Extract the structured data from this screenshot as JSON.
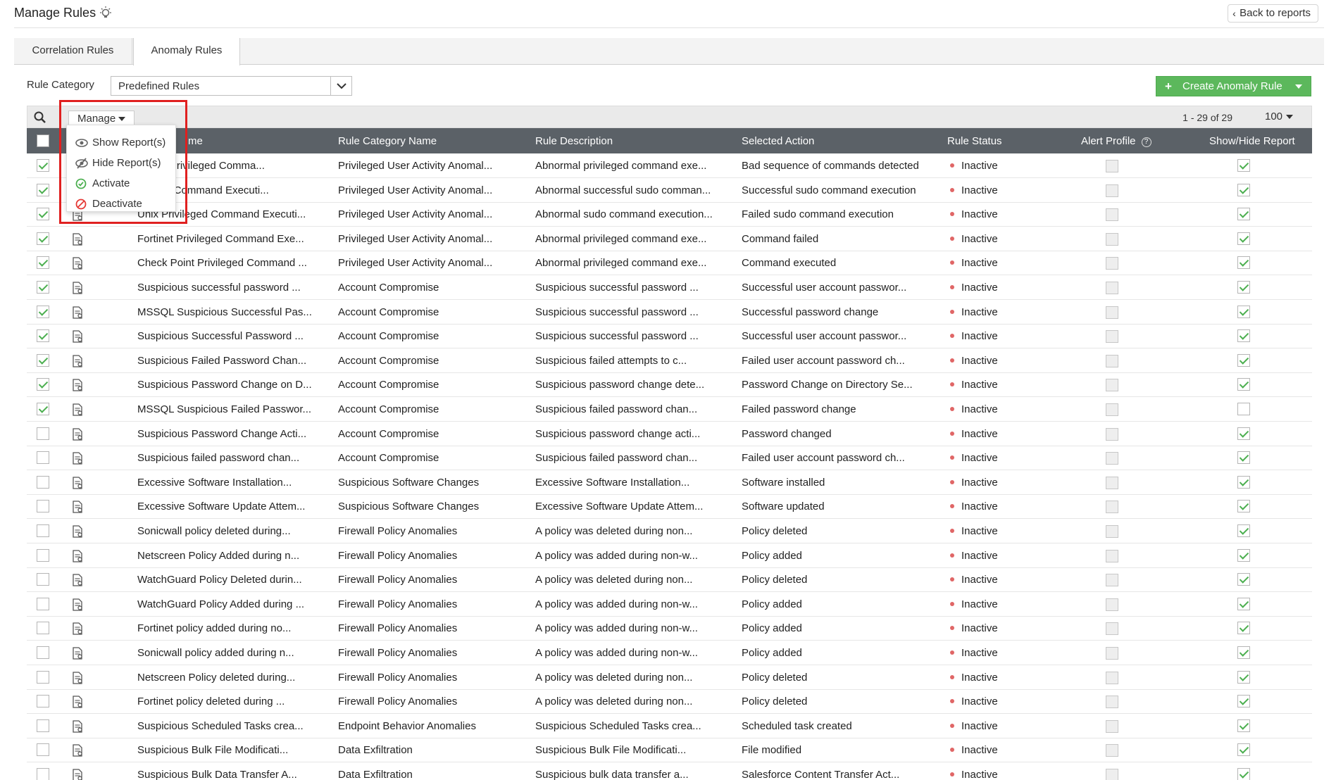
{
  "header": {
    "title": "Manage Rules",
    "back_label": "Back to reports"
  },
  "tabs": [
    {
      "label": "Correlation Rules"
    },
    {
      "label": "Anomaly Rules",
      "active": true
    }
  ],
  "filter": {
    "label": "Rule Category",
    "value": "Predefined Rules"
  },
  "create_button": {
    "label": "Create Anomaly Rule"
  },
  "toolbar": {
    "manage_label": "Manage",
    "pager": "1 - 29 of 29",
    "per_page": "100"
  },
  "manage_menu": [
    {
      "label": "Show Report(s)",
      "icon": "eye-icon"
    },
    {
      "label": "Hide Report(s)",
      "icon": "eye-slash-icon"
    },
    {
      "label": "Activate",
      "icon": "check-circle-icon",
      "color": "#4caf50"
    },
    {
      "label": "Deactivate",
      "icon": "ban-icon",
      "color": "#e53935"
    }
  ],
  "columns": [
    "me",
    "Rule Category Name",
    "Rule Description",
    "Selected Action",
    "Rule Status",
    "Alert Profile",
    "Show/Hide Report"
  ],
  "rows": [
    {
      "checked": true,
      "name": "server Privileged Comma...",
      "category": "Privileged User Activity Anomal...",
      "description": "Abnormal privileged command exe...",
      "action": "Bad sequence of commands detected",
      "status": "Inactive",
      "show": true
    },
    {
      "checked": true,
      "name": "vileged Command Executi...",
      "category": "Privileged User Activity Anomal...",
      "description": "Abnormal successful sudo comman...",
      "action": "Successful sudo command execution",
      "status": "Inactive",
      "show": true
    },
    {
      "checked": true,
      "name": "Unix Privileged Command Executi...",
      "category": "Privileged User Activity Anomal...",
      "description": "Abnormal sudo command execution...",
      "action": "Failed sudo command execution",
      "status": "Inactive",
      "show": true
    },
    {
      "checked": true,
      "name": "Fortinet Privileged Command Exe...",
      "category": "Privileged User Activity Anomal...",
      "description": "Abnormal privileged command exe...",
      "action": "Command failed",
      "status": "Inactive",
      "show": true
    },
    {
      "checked": true,
      "name": "Check Point Privileged Command ...",
      "category": "Privileged User Activity Anomal...",
      "description": "Abnormal privileged command exe...",
      "action": "Command executed",
      "status": "Inactive",
      "show": true
    },
    {
      "checked": true,
      "name": "Suspicious successful password ...",
      "category": "Account Compromise",
      "description": "Suspicious successful password ...",
      "action": "Successful user account passwor...",
      "status": "Inactive",
      "show": true
    },
    {
      "checked": true,
      "name": "MSSQL Suspicious Successful Pas...",
      "category": "Account Compromise",
      "description": "Suspicious successful password ...",
      "action": "Successful password change",
      "status": "Inactive",
      "show": true
    },
    {
      "checked": true,
      "name": "Suspicious Successful Password ...",
      "category": "Account Compromise",
      "description": "Suspicious successful password ...",
      "action": "Successful user account passwor...",
      "status": "Inactive",
      "show": true
    },
    {
      "checked": true,
      "name": "Suspicious Failed Password Chan...",
      "category": "Account Compromise",
      "description": "Suspicious failed attempts to c...",
      "action": "Failed user account password ch...",
      "status": "Inactive",
      "show": true
    },
    {
      "checked": true,
      "name": "Suspicious Password Change on D...",
      "category": "Account Compromise",
      "description": "Suspicious password change dete...",
      "action": "Password Change on Directory Se...",
      "status": "Inactive",
      "show": true
    },
    {
      "checked": true,
      "name": "MSSQL Suspicious Failed Passwor...",
      "category": "Account Compromise",
      "description": "Suspicious failed password chan...",
      "action": "Failed password change",
      "status": "Inactive",
      "show": false
    },
    {
      "checked": false,
      "name": "Suspicious Password Change Acti...",
      "category": "Account Compromise",
      "description": "Suspicious password change acti...",
      "action": "Password changed",
      "status": "Inactive",
      "show": true
    },
    {
      "checked": false,
      "name": "Suspicious failed password chan...",
      "category": "Account Compromise",
      "description": "Suspicious failed password chan...",
      "action": "Failed user account password ch...",
      "status": "Inactive",
      "show": true
    },
    {
      "checked": false,
      "name": "Excessive Software Installation...",
      "category": "Suspicious Software Changes",
      "description": "Excessive Software Installation...",
      "action": "Software installed",
      "status": "Inactive",
      "show": true
    },
    {
      "checked": false,
      "name": "Excessive Software Update Attem...",
      "category": "Suspicious Software Changes",
      "description": "Excessive Software Update Attem...",
      "action": "Software updated",
      "status": "Inactive",
      "show": true
    },
    {
      "checked": false,
      "name": "Sonicwall policy deleted during...",
      "category": "Firewall Policy Anomalies",
      "description": "A policy was deleted during non...",
      "action": "Policy deleted",
      "status": "Inactive",
      "show": true
    },
    {
      "checked": false,
      "name": "Netscreen Policy Added during n...",
      "category": "Firewall Policy Anomalies",
      "description": "A policy was added during non-w...",
      "action": "Policy added",
      "status": "Inactive",
      "show": true
    },
    {
      "checked": false,
      "name": "WatchGuard Policy Deleted durin...",
      "category": "Firewall Policy Anomalies",
      "description": "A policy was deleted during non...",
      "action": "Policy deleted",
      "status": "Inactive",
      "show": true
    },
    {
      "checked": false,
      "name": "WatchGuard Policy Added during ...",
      "category": "Firewall Policy Anomalies",
      "description": "A policy was added during non-w...",
      "action": "Policy added",
      "status": "Inactive",
      "show": true
    },
    {
      "checked": false,
      "name": "Fortinet policy added during no...",
      "category": "Firewall Policy Anomalies",
      "description": "A policy was added during non-w...",
      "action": "Policy added",
      "status": "Inactive",
      "show": true
    },
    {
      "checked": false,
      "name": "Sonicwall policy added during n...",
      "category": "Firewall Policy Anomalies",
      "description": "A policy was added during non-w...",
      "action": "Policy added",
      "status": "Inactive",
      "show": true
    },
    {
      "checked": false,
      "name": "Netscreen Policy deleted during...",
      "category": "Firewall Policy Anomalies",
      "description": "A policy was deleted during non...",
      "action": "Policy deleted",
      "status": "Inactive",
      "show": true
    },
    {
      "checked": false,
      "name": "Fortinet policy deleted during ...",
      "category": "Firewall Policy Anomalies",
      "description": "A policy was deleted during non...",
      "action": "Policy deleted",
      "status": "Inactive",
      "show": true
    },
    {
      "checked": false,
      "name": "Suspicious Scheduled Tasks crea...",
      "category": "Endpoint Behavior Anomalies",
      "description": "Suspicious Scheduled Tasks crea...",
      "action": "Scheduled task created",
      "status": "Inactive",
      "show": true
    },
    {
      "checked": false,
      "name": "Suspicious Bulk File Modificati...",
      "category": "Data Exfiltration",
      "description": "Suspicious Bulk File Modificati...",
      "action": "File modified",
      "status": "Inactive",
      "show": true
    },
    {
      "checked": false,
      "name": "Suspicious Bulk Data Transfer A...",
      "category": "Data Exfiltration",
      "description": "Suspicious bulk data transfer a...",
      "action": "Salesforce Content Transfer Act...",
      "status": "Inactive",
      "show": true
    }
  ]
}
